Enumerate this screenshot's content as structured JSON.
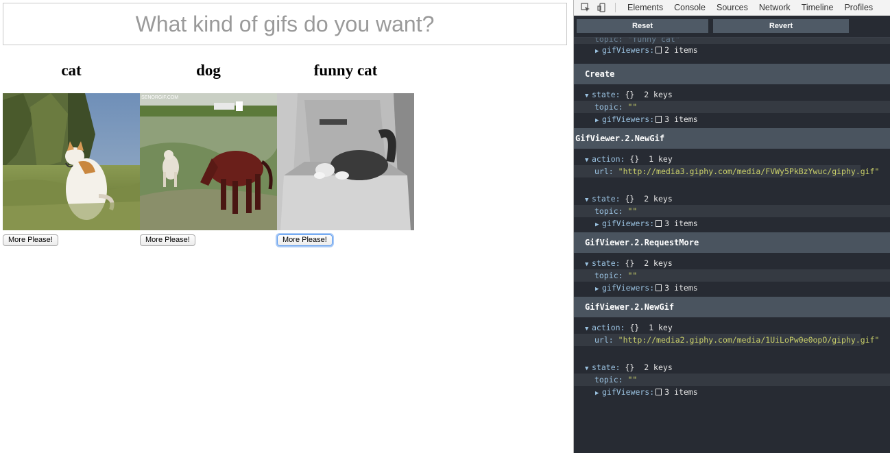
{
  "app": {
    "input_placeholder": "What kind of gifs do you want?",
    "viewers": [
      {
        "topic": "cat",
        "button_label": "More Please!"
      },
      {
        "topic": "dog",
        "button_label": "More Please!"
      },
      {
        "topic": "funny cat",
        "button_label": "More Please!"
      }
    ]
  },
  "devtools": {
    "tabs": [
      "Elements",
      "Console",
      "Sources",
      "Network",
      "Timeline",
      "Profiles"
    ],
    "buttons": {
      "reset": "Reset",
      "revert": "Revert"
    },
    "log": {
      "top_partial": {
        "topic_line": "topic: \"funny cat\"",
        "key": "gifViewers:",
        "count": "2 items"
      },
      "entries": [
        {
          "title": "Create",
          "state": {
            "key": "state:",
            "type": "{}",
            "count": "2 keys",
            "topic_key": "topic:",
            "topic_val": "\"\"",
            "viewers_key": "gifViewers:",
            "viewers_count": "3 items"
          }
        },
        {
          "title": "GifViewer.2.NewGif",
          "action": {
            "key": "action:",
            "type": "{}",
            "count": "1 key",
            "url_key": "url:",
            "url_val": "\"http://media3.giphy.com/media/FVWy5PkBzYwuc/giphy.gif\""
          },
          "state": {
            "key": "state:",
            "type": "{}",
            "count": "2 keys",
            "topic_key": "topic:",
            "topic_val": "\"\"",
            "viewers_key": "gifViewers:",
            "viewers_count": "3 items"
          }
        },
        {
          "title": "GifViewer.2.RequestMore",
          "state": {
            "key": "state:",
            "type": "{}",
            "count": "2 keys",
            "topic_key": "topic:",
            "topic_val": "\"\"",
            "viewers_key": "gifViewers:",
            "viewers_count": "3 items"
          }
        },
        {
          "title": "GifViewer.2.NewGif",
          "action": {
            "key": "action:",
            "type": "{}",
            "count": "1 key",
            "url_key": "url:",
            "url_val": "\"http://media2.giphy.com/media/1UiLoPw0e0opO/giphy.gif\""
          },
          "state": {
            "key": "state:",
            "type": "{}",
            "count": "2 keys",
            "topic_key": "topic:",
            "topic_val": "\"\"",
            "viewers_key": "gifViewers:",
            "viewers_count": "3 items"
          }
        }
      ]
    }
  },
  "colors": {
    "devtools_bg": "#272b33",
    "entry_header": "#4a545f",
    "key": "#9bc3e2",
    "string": "#cad06a"
  }
}
